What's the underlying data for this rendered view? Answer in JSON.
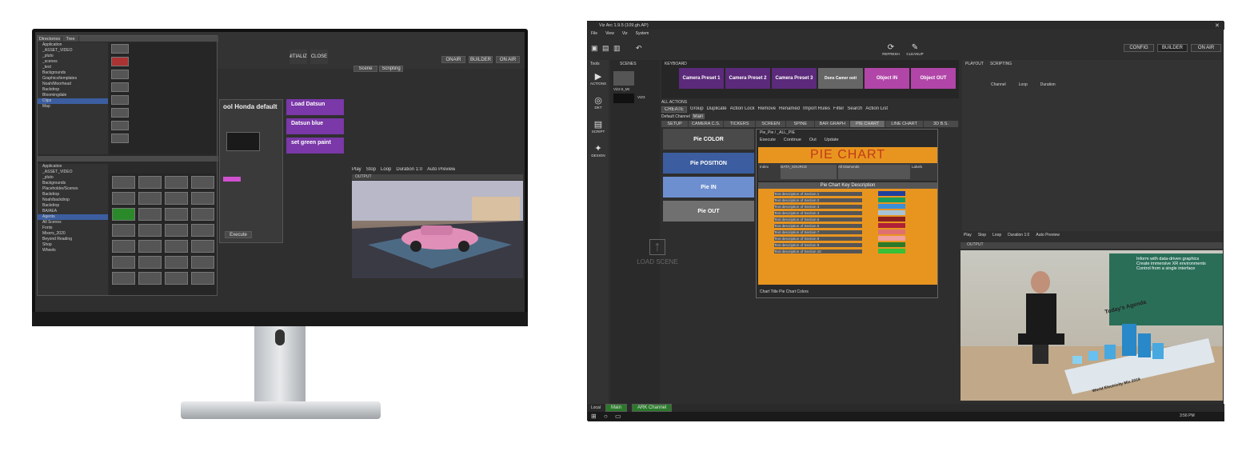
{
  "left_monitor": {
    "tree_tabs": [
      "Directories",
      "Tree"
    ],
    "tree_top_items": [
      "Application",
      "_ASSET_VIDEO",
      "_pluto",
      "_scenes",
      "_text",
      "Backgrounds",
      "Graphics/templates",
      "Noah/Moorhead",
      "Backdrop",
      "Bloomingdale",
      "Clips",
      "Map"
    ],
    "tree_bottom_items": [
      "Application",
      "_ASSET_VIDEO",
      "_pluto",
      "Backgrounds",
      "Placeholder/Scenes",
      "Backdrop",
      "Noah/backdrop",
      "Backdrop",
      "BA/AEA",
      "Agents",
      "All Scenes",
      "Fonts",
      "Mixers_2020",
      "Beyond Reading",
      "Shop",
      "Wheels"
    ],
    "header_buttons": [
      "ONAIR",
      "INITIALIZE",
      "CLOSE"
    ],
    "scene_title": "ool Honda default",
    "purple_buttons": [
      "Load Datsun",
      "Datsun blue",
      "set green paint"
    ],
    "toolbar": [
      "Play",
      "Stop",
      "Loop",
      "Duration 1:0",
      "Auto Preview"
    ],
    "right_buttons": [
      "Scene",
      "Scripting"
    ],
    "stage_button": "Execute",
    "output_label": "OUTPUT"
  },
  "right_monitor": {
    "window_title": "Viz Arc 1.9.5 (109.gh.AP)",
    "menu": [
      "File",
      "View",
      "Viz",
      "System"
    ],
    "top_buttons": [
      "REFRESH",
      "CLEANUP"
    ],
    "mode_buttons": [
      "CONFIG",
      "BUILDER",
      "ON AIR"
    ],
    "sidebar": [
      "Tools",
      "ACTIONS",
      "DKT",
      "SCRIPT",
      "DESIGN"
    ],
    "scenes_label": "SCENES",
    "keyboard_label": "KEYBOARD",
    "scene_names": [
      "Viz2.5_Mt",
      "VIZ3"
    ],
    "cameras": [
      {
        "label": "Camera Preset 1",
        "color": "#5b2a7a"
      },
      {
        "label": "Camera Preset 2",
        "color": "#5b2a7a"
      },
      {
        "label": "Camera Preset 3",
        "color": "#5b2a7a"
      },
      {
        "label": "Dons Camer ooti",
        "color": "#555555"
      },
      {
        "label": "Object IN",
        "color": "#b145a8"
      },
      {
        "label": "Object OUT",
        "color": "#b145a8"
      }
    ],
    "all_actions_label": "ALL ACTIONS",
    "action_toolbar": [
      "CREATE",
      "Group",
      "Duplicate",
      "Action Lock",
      "Remove",
      "Renamed",
      "Import Rules",
      "Filter",
      "Search",
      "Action List"
    ],
    "default_channel": "Default Channel",
    "channel_btn": "Main",
    "tabs": [
      "SETUP",
      "CAMERA C.S.",
      "TICKERS",
      "SCREEN",
      "SPINE",
      "BAR GRAPH",
      "PIE CHART",
      "LINE CHART",
      "3D B.S."
    ],
    "pie_actions": [
      {
        "label": "Pie COLOR",
        "color": "#4a4a4a"
      },
      {
        "label": "Pie POSITION",
        "color": "#3c5ea0"
      },
      {
        "label": "Pie IN",
        "color": "#6d8fd0"
      },
      {
        "label": "Pie OUT",
        "color": "#707070"
      }
    ],
    "pie_editor": {
      "title": "Pie_Pie / _ALL_PIE",
      "buttons": [
        "Execute",
        "Continue",
        "Out",
        "Update"
      ],
      "chart_title": "PIE CHART",
      "fields": [
        "Index",
        "DATA_SOURCE",
        "All Diamonds",
        "Labels"
      ],
      "key_header": "Pie Chart Key Description",
      "rows": [
        {
          "label": "Text description of Section 1",
          "color": "#1f3f9e"
        },
        {
          "label": "Text description of Section 2",
          "color": "#1a9d5a"
        },
        {
          "label": "Text description of Section 3",
          "color": "#3b8fd9"
        },
        {
          "label": "Text description of Section 4",
          "color": "#a8c4d8"
        },
        {
          "label": "Text description of Section 5",
          "color": "#8a2020"
        },
        {
          "label": "Text description of Section 6",
          "color": "#b02038"
        },
        {
          "label": "Text description of Section 7",
          "color": "#e07070"
        },
        {
          "label": "Text description of Section 8",
          "color": "#f0a0a0"
        },
        {
          "label": "Text description of Section 9",
          "color": "#2a7a2a"
        },
        {
          "label": "Text description of Section 10",
          "color": "#38c038"
        }
      ],
      "footer": "Chart Title  Pie Chart Colors"
    },
    "drop_label": "LOAD SCENE",
    "right_tabs": [
      "PLAYOUT",
      "SCRIPTING"
    ],
    "right_cols": [
      "Channel",
      "Loop",
      "Duration"
    ],
    "preview_toolbar": [
      "Play",
      "Stop",
      "Loop",
      "Duration 1:0",
      "Auto Preview"
    ],
    "output_label": "OUTPUT",
    "preview_text": [
      "Inform with data-driven graphics",
      "Create immersive XR environments",
      "Control from a single interface"
    ],
    "agenda": "Today's Agenda",
    "world_label": "World Electricity Mix 2019",
    "bottom_tabs": [
      "Local",
      "Main",
      "ARK Channel"
    ],
    "time": "3:56 PM"
  }
}
